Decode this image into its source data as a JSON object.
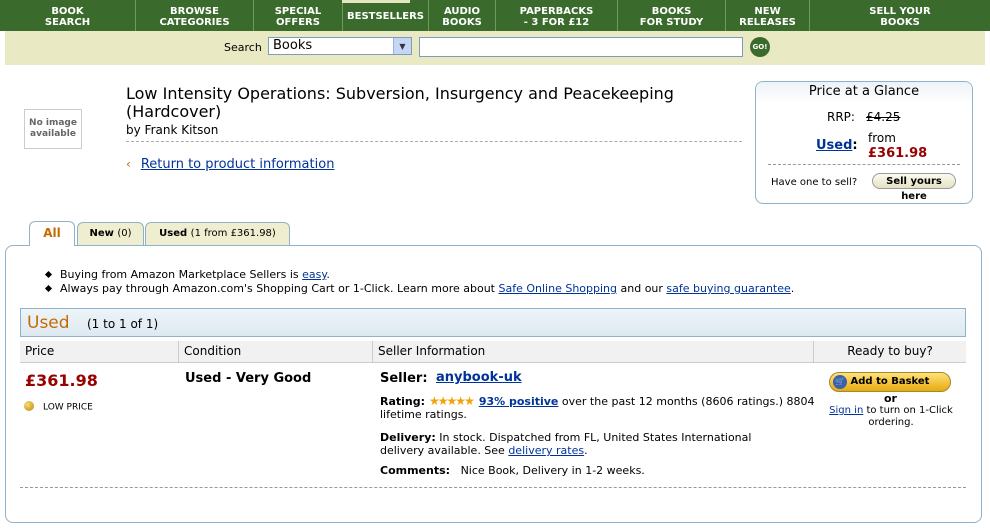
{
  "nav": {
    "items": [
      {
        "label": "BOOK\nSEARCH",
        "width": 0
      },
      {
        "label": "BROWSE\nCATEGORIES"
      },
      {
        "label": "SPECIAL\nOFFERS"
      },
      {
        "label": "BESTSELLERS"
      },
      {
        "label": "AUDIO\nBOOKS"
      },
      {
        "label": "PAPERBACKS\n- 3 FOR £12"
      },
      {
        "label": "BOOKS\nFOR STUDY"
      },
      {
        "label": "NEW\nRELEASES"
      },
      {
        "label": "SELL YOUR\nBOOKS"
      }
    ]
  },
  "search": {
    "label": "Search",
    "category": "Books",
    "query": "",
    "go": "GO!"
  },
  "product": {
    "no_image": "No image available",
    "title": "Low Intensity Operations: Subversion, Insurgency and Peacekeeping (Hardcover)",
    "author": "by Frank Kitson",
    "return_link": "Return to product information",
    "return_arrow": "‹"
  },
  "glance": {
    "heading": "Price at a Glance",
    "rrp_label": "RRP:",
    "rrp": "£4.25",
    "used_label": "Used",
    "used_colon": ":",
    "from": "from",
    "used_price": "£361.98",
    "sell_question": "Have one to sell?",
    "sell_button": "Sell yours here"
  },
  "tabs": {
    "all": "All",
    "new": "New",
    "new_count": "(0)",
    "used": "Used",
    "used_count": "(1 from £361.98)"
  },
  "bullets": {
    "b1_text": "Buying from Amazon Marketplace Sellers is ",
    "b1_link": "easy",
    "b1_end": ".",
    "b2_text": "Always pay through Amazon.com's Shopping Cart or 1-Click. Learn more about ",
    "b2_link1": "Safe Online Shopping",
    "b2_mid": " and our ",
    "b2_link2": "safe buying guarantee",
    "b2_end": "."
  },
  "listing": {
    "section_title": "Used",
    "section_count": "(1 to 1 of 1)",
    "columns": [
      "Price",
      "Condition",
      "Seller Information",
      "Ready to buy?"
    ],
    "price": "£361.98",
    "low_price": "LOW PRICE",
    "condition": "Used - Very Good",
    "seller_label": "Seller:",
    "seller_name": "anybook-uk",
    "rating_label": "Rating:",
    "rating_stars": 4.5,
    "rating_positive": "93% positive",
    "rating_text": " over the past 12 months (8606 ratings.) 8804 lifetime ratings.",
    "delivery_label": "Delivery:",
    "delivery_text": " In stock. Dispatched from FL, United States International delivery available. See ",
    "delivery_link": "delivery rates",
    "delivery_end": ".",
    "comments_label": "Comments:",
    "comments_text": "Nice Book, Delivery in 1-2 weeks.",
    "basket_button": "Add to Basket",
    "or": "or",
    "signin_link": "Sign in",
    "signin_text": " to turn on 1-Click ordering."
  }
}
